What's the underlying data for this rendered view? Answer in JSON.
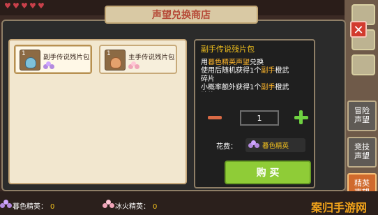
{
  "title": "声望兑换商店",
  "close_icon": "close-icon",
  "side_tabs": [
    {
      "label": "冒险\n声望"
    },
    {
      "label": "竞技\n声望"
    },
    {
      "label": "精英\n声望"
    }
  ],
  "cards": [
    {
      "level": "1",
      "name": "副手传说残片包",
      "currency_icon": "purple-flower-icon",
      "selected": true
    },
    {
      "level": "1",
      "name": "主手传说残片包",
      "currency_icon": "pink-flower-icon",
      "selected": false
    }
  ],
  "detail": {
    "title": "副手传说残片包",
    "desc_lines": [
      {
        "pre": "用",
        "hl": "暮色精英声望",
        "post": "兑换"
      },
      {
        "pre": "使用后随机获得1个",
        "hl": "副手",
        "post": "橙武"
      },
      {
        "pre": "碎片",
        "hl": "",
        "post": ""
      },
      {
        "pre": "小概率额外获得1个",
        "hl": "副手",
        "post": "橙武"
      },
      {
        "pre": "碎片",
        "hl": "",
        "post": ""
      }
    ],
    "quantity": "1",
    "cost_label": "花费：",
    "cost_currency": "暮色精英",
    "buy_label": "购 买"
  },
  "bottom": {
    "item1_label": "暮色精英：",
    "item1_value": "0",
    "item2_label": "冰火精英：",
    "item2_value": "0"
  },
  "watermark": "案归手游网",
  "colors": {
    "accent": "#f3c11d",
    "buy_button": "#8fcc37",
    "close_button": "#d23a2e",
    "active_tab": "#d06a2d"
  }
}
